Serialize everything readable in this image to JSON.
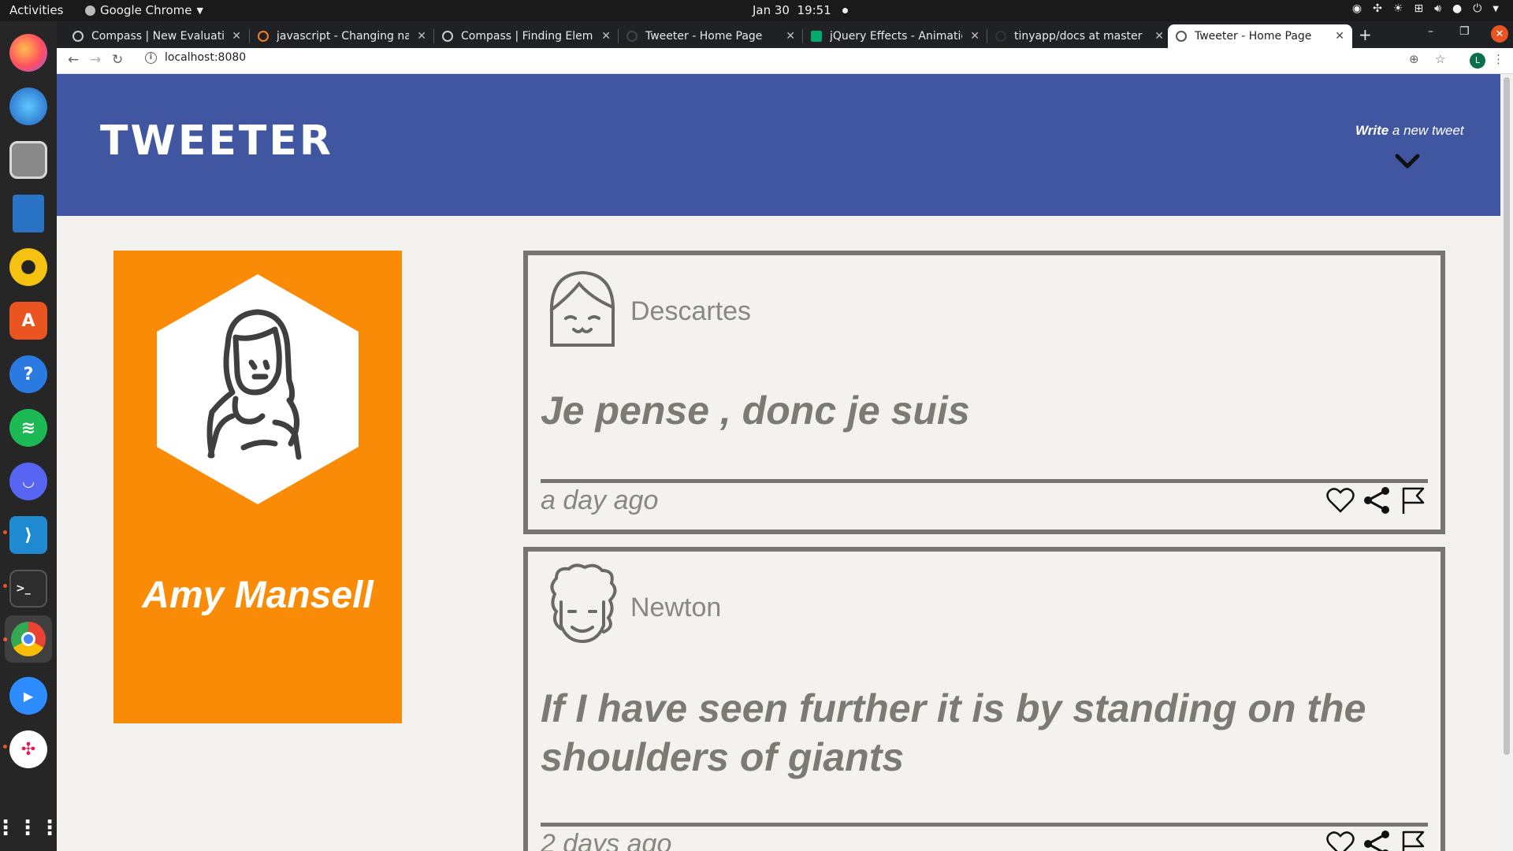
{
  "os": {
    "activities": "Activities",
    "app_menu": "Google Chrome",
    "date": "Jan 30",
    "time": "19:51"
  },
  "browser": {
    "tabs": [
      {
        "title": "Compass | New Evaluatio"
      },
      {
        "title": "javascript - Changing nav"
      },
      {
        "title": "Compass | Finding Eleme"
      },
      {
        "title": "Tweeter - Home Page"
      },
      {
        "title": "jQuery Effects - Animatio"
      },
      {
        "title": "tinyapp/docs at master ·"
      },
      {
        "title": "Tweeter - Home Page",
        "active": true
      }
    ],
    "url": "localhost:8080",
    "profile_initial": "L"
  },
  "nav": {
    "brand": "TWEETER",
    "write_bold": "Write",
    "write_rest": " a new tweet"
  },
  "profile": {
    "name": "Amy Mansell",
    "card_color": "#f98b07"
  },
  "tweets": [
    {
      "author": "Descartes",
      "content": "Je pense , donc je suis",
      "time": "a day ago"
    },
    {
      "author": "Newton",
      "content": "If I have seen further it is by standing on the shoulders of giants",
      "time": "2 days ago"
    }
  ],
  "colors": {
    "nav": "#4056a1",
    "page_bg": "#f4f2ee",
    "tweet_border": "#777571"
  }
}
